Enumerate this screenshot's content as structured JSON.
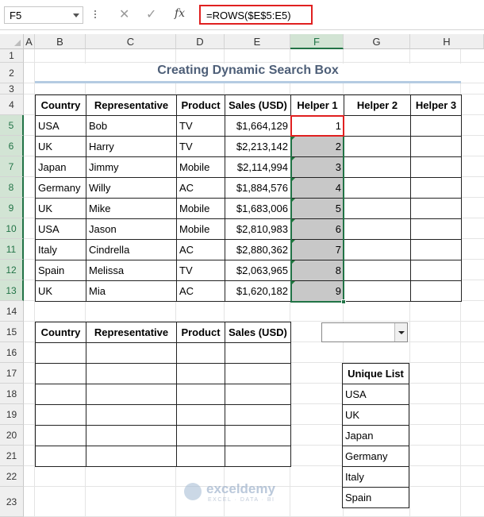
{
  "formula_bar": {
    "name_box": "F5",
    "cancel_glyph": "✕",
    "enter_glyph": "✓",
    "fx_label": "fx",
    "formula": "=ROWS($E$5:E5)"
  },
  "columns": [
    "A",
    "B",
    "C",
    "D",
    "E",
    "F",
    "G",
    "H"
  ],
  "selected_column": "F",
  "rows": [
    "1",
    "2",
    "3",
    "4",
    "5",
    "6",
    "7",
    "8",
    "9",
    "10",
    "11",
    "12",
    "13",
    "14",
    "15",
    "16",
    "17",
    "18",
    "19",
    "20",
    "21",
    "22",
    "23"
  ],
  "selected_rows": [
    "5",
    "6",
    "7",
    "8",
    "9",
    "10",
    "11",
    "12",
    "13"
  ],
  "title": "Creating Dynamic Search Box",
  "main_table": {
    "headers": [
      "Country",
      "Representative",
      "Product",
      "Sales (USD)",
      "Helper 1",
      "Helper 2",
      "Helper 3"
    ],
    "rows": [
      [
        "USA",
        "Bob",
        "TV",
        "$1,664,129",
        "1",
        "",
        ""
      ],
      [
        "UK",
        "Harry",
        "TV",
        "$2,213,142",
        "2",
        "",
        ""
      ],
      [
        "Japan",
        "Jimmy",
        "Mobile",
        "$2,114,994",
        "3",
        "",
        ""
      ],
      [
        "Germany",
        "Willy",
        "AC",
        "$1,884,576",
        "4",
        "",
        ""
      ],
      [
        "UK",
        "Mike",
        "Mobile",
        "$1,683,006",
        "5",
        "",
        ""
      ],
      [
        "USA",
        "Jason",
        "Mobile",
        "$2,810,983",
        "6",
        "",
        ""
      ],
      [
        "Italy",
        "Cindrella",
        "AC",
        "$2,880,362",
        "7",
        "",
        ""
      ],
      [
        "Spain",
        "Melissa",
        "TV",
        "$2,063,965",
        "8",
        "",
        ""
      ],
      [
        "UK",
        "Mia",
        "AC",
        "$1,620,182",
        "9",
        "",
        ""
      ]
    ]
  },
  "result_table": {
    "headers": [
      "Country",
      "Representative",
      "Product",
      "Sales (USD)"
    ],
    "empty_rows": 6
  },
  "dropdown": {
    "selected": ""
  },
  "unique_list": {
    "header": "Unique List",
    "items": [
      "USA",
      "UK",
      "Japan",
      "Germany",
      "Italy",
      "Spain"
    ]
  },
  "watermark": {
    "name": "exceldemy",
    "tagline": "EXCEL · DATA · BI"
  },
  "colors": {
    "accent_green": "#217346",
    "highlight_red": "#e02020",
    "helper_fill": "#c8c8c8",
    "title_color": "#4e5f78"
  }
}
